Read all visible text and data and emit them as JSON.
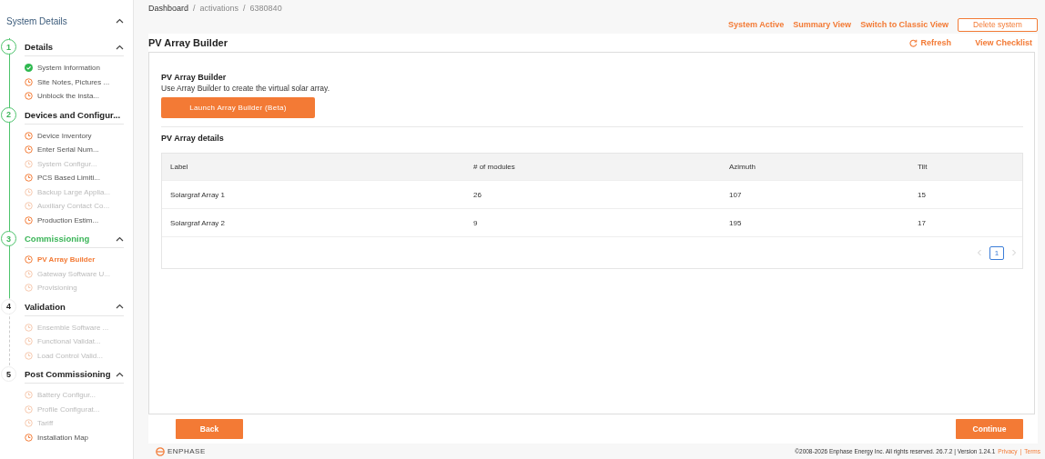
{
  "sidebar": {
    "title": "System Details",
    "steps": [
      {
        "number": "1",
        "title": "Details",
        "done": true,
        "current": false,
        "items": [
          {
            "label": "System Information",
            "completed": true,
            "disabled": false,
            "selected": false
          },
          {
            "label": "Site Notes, Pictures ...",
            "completed": false,
            "disabled": false,
            "selected": false
          },
          {
            "label": "Unblock the insta...",
            "completed": false,
            "disabled": false,
            "selected": false
          }
        ]
      },
      {
        "number": "2",
        "title": "Devices and Configur...",
        "done": true,
        "current": false,
        "items": [
          {
            "label": "Device Inventory",
            "completed": false,
            "disabled": false,
            "selected": false
          },
          {
            "label": "Enter Serial Num...",
            "completed": false,
            "disabled": false,
            "selected": false
          },
          {
            "label": "System Configur...",
            "completed": false,
            "disabled": true,
            "selected": false
          },
          {
            "label": "PCS Based Limiti...",
            "completed": false,
            "disabled": false,
            "selected": false
          },
          {
            "label": "Backup Large Applia...",
            "completed": false,
            "disabled": true,
            "selected": false
          },
          {
            "label": "Auxiliary Contact Co...",
            "completed": false,
            "disabled": true,
            "selected": false
          },
          {
            "label": "Production Estim...",
            "completed": false,
            "disabled": false,
            "selected": false
          }
        ]
      },
      {
        "number": "3",
        "title": "Commissioning",
        "done": true,
        "current": true,
        "items": [
          {
            "label": "PV Array Builder",
            "completed": false,
            "disabled": false,
            "selected": true
          },
          {
            "label": "Gateway Software U...",
            "completed": false,
            "disabled": true,
            "selected": false
          },
          {
            "label": "Provisioning",
            "completed": false,
            "disabled": true,
            "selected": false
          }
        ]
      },
      {
        "number": "4",
        "title": "Validation",
        "done": false,
        "current": false,
        "items": [
          {
            "label": "Ensemble Software ...",
            "completed": false,
            "disabled": true,
            "selected": false
          },
          {
            "label": "Functional Validat...",
            "completed": false,
            "disabled": true,
            "selected": false
          },
          {
            "label": "Load Control Valid...",
            "completed": false,
            "disabled": true,
            "selected": false
          }
        ]
      },
      {
        "number": "5",
        "title": "Post Commissioning",
        "done": false,
        "current": false,
        "items": [
          {
            "label": "Battery Configur...",
            "completed": false,
            "disabled": true,
            "selected": false
          },
          {
            "label": "Profile Configurat...",
            "completed": false,
            "disabled": true,
            "selected": false
          },
          {
            "label": "Tariff",
            "completed": false,
            "disabled": true,
            "selected": false
          },
          {
            "label": "Installation Map",
            "completed": false,
            "disabled": false,
            "selected": false
          }
        ]
      }
    ]
  },
  "breadcrumb": [
    {
      "kind": "link",
      "text": "Dashboard"
    },
    {
      "kind": "separator",
      "text": "/"
    },
    {
      "kind": "link",
      "text": "activations"
    },
    {
      "kind": "separator",
      "text": "/"
    },
    {
      "kind": "current",
      "text": "6380840"
    }
  ],
  "header_links": [
    "System Active",
    "Summary View",
    "Switch to Classic View"
  ],
  "delete_button": "Delete system",
  "card": {
    "title": "PV Array Builder",
    "refresh": "Refresh",
    "view_checklist": "View Checklist",
    "section_title": "PV Array Builder",
    "description": "Use Array Builder to create the virtual solar array.",
    "launch_button": "Launch Array Builder (Beta)",
    "details_title": "PV Array details",
    "table": {
      "columns": [
        "Label",
        "# of modules",
        "Azimuth",
        "Tilt"
      ],
      "rows": [
        [
          "Solargraf Array 1",
          "26",
          "107",
          "15"
        ],
        [
          "Solargraf Array 2",
          "9",
          "195",
          "17"
        ]
      ]
    },
    "pagination": {
      "pages": [
        {
          "label": "1",
          "selected": true
        }
      ]
    }
  },
  "back_button": "Back",
  "continue_button": "Continue",
  "footer": {
    "logo": "ENPHASE",
    "copyright": "©2008-2026 Enphase Energy Inc. All rights reserved. 26.7.2 | Version 1.24.1",
    "privacy_link": "Privacy",
    "link_separator": "|",
    "terms_link": "Terms"
  }
}
